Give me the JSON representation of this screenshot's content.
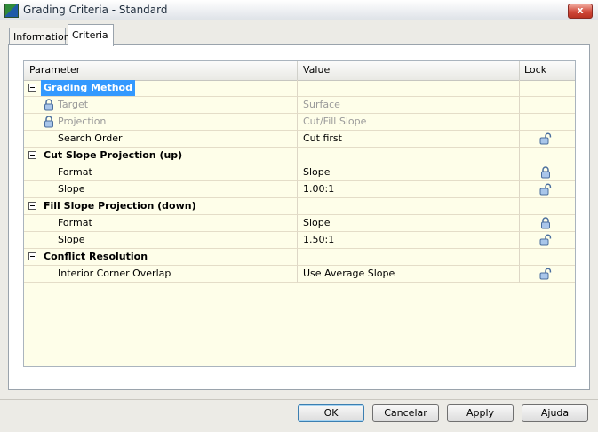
{
  "window": {
    "title": "Grading Criteria - Standard",
    "close_label": "x"
  },
  "tabs": [
    {
      "label": "Information"
    },
    {
      "label": "Criteria"
    }
  ],
  "grid": {
    "headers": {
      "parameter": "Parameter",
      "value": "Value",
      "lock": "Lock"
    },
    "rows": [
      {
        "type": "group",
        "label": "Grading Method"
      },
      {
        "type": "item",
        "label": "Target",
        "value": "Surface",
        "disabled": true
      },
      {
        "type": "item",
        "label": "Projection",
        "value": "Cut/Fill Slope",
        "disabled": true
      },
      {
        "type": "item",
        "label": "Search Order",
        "value": "Cut first"
      },
      {
        "type": "group",
        "label": "Cut Slope Projection (up)"
      },
      {
        "type": "item",
        "label": "Format",
        "value": "Slope"
      },
      {
        "type": "item",
        "label": "Slope",
        "value": "1.00:1"
      },
      {
        "type": "group",
        "label": "Fill Slope Projection (down)"
      },
      {
        "type": "item",
        "label": "Format",
        "value": "Slope"
      },
      {
        "type": "item",
        "label": "Slope",
        "value": "1.50:1"
      },
      {
        "type": "group",
        "label": "Conflict Resolution"
      },
      {
        "type": "item",
        "label": "Interior Corner Overlap",
        "value": "Use Average Slope"
      }
    ]
  },
  "buttons": {
    "ok": "OK",
    "cancel": "Cancelar",
    "apply": "Apply",
    "help": "Ajuda"
  },
  "colors": {
    "selection": "#3399ff",
    "grid_background": "#fefee9"
  }
}
